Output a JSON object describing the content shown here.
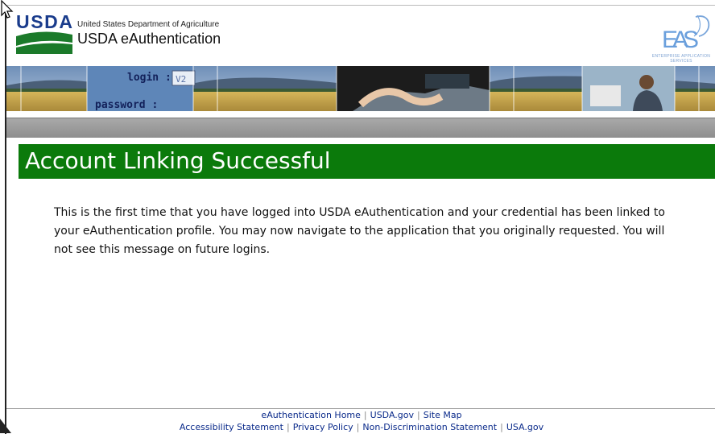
{
  "header": {
    "logo_text": "USDA",
    "department": "United States Department of Agriculture",
    "app_title": "USDA eAuthentication",
    "eas_logo_text": "EAS",
    "eas_subtitle": "ENTERPRISE APPLICATION SERVICES"
  },
  "banner": {
    "login_label": "login :",
    "login_value": "V2",
    "password_label": "password :"
  },
  "main": {
    "title": "Account Linking Successful",
    "message": "This is the first time that you have logged into USDA eAuthentication and your credential has been linked to your eAuthentication profile. You may now navigate to the application that you originally requested. You will not see this message on future logins."
  },
  "footer": {
    "row1": [
      "eAuthentication Home",
      "USDA.gov",
      "Site Map"
    ],
    "row2": [
      "Accessibility Statement",
      "Privacy Policy",
      "Non-Discrimination Statement",
      "USA.gov"
    ]
  },
  "colors": {
    "title_bar": "#0b7a0b",
    "link": "#0a2a8a",
    "usda_blue": "#1a3c8c",
    "usda_green": "#1b7a2a"
  }
}
